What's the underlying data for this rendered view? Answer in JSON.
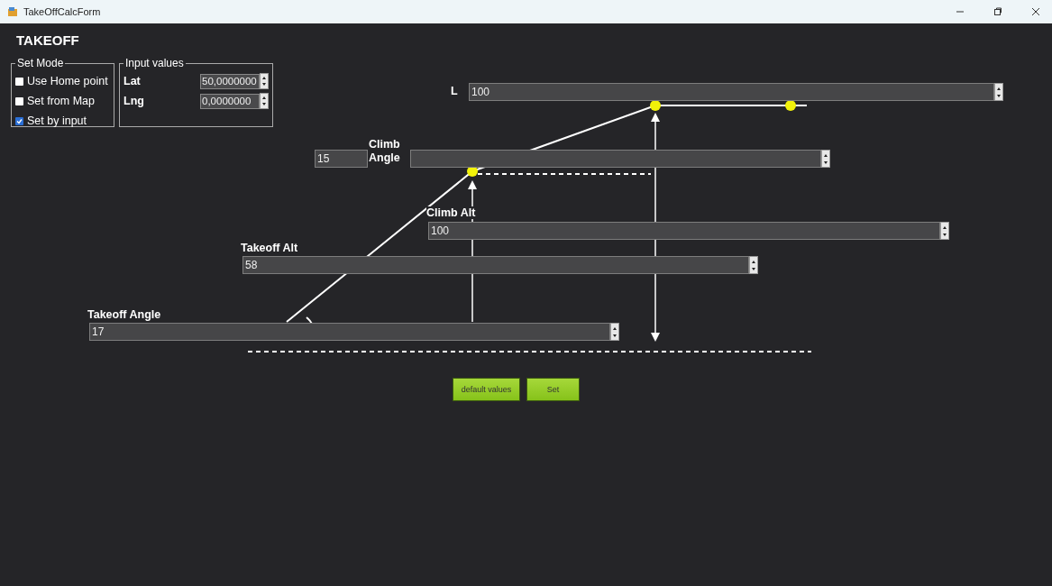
{
  "window": {
    "title": "TakeOffCalcForm"
  },
  "heading": "TAKEOFF",
  "set_mode": {
    "title": "Set Mode",
    "options": [
      {
        "label": "Use Home point",
        "checked": false
      },
      {
        "label": "Set from Map",
        "checked": false
      },
      {
        "label": "Set by input",
        "checked": true
      }
    ]
  },
  "input_values": {
    "title": "Input values",
    "fields": [
      {
        "label": "Lat",
        "value": "50,0000000"
      },
      {
        "label": "Lng",
        "value": "0,0000000"
      }
    ]
  },
  "diagram": {
    "l": {
      "label": "L",
      "value": "100"
    },
    "climb_angle": {
      "label": "Climb Angle",
      "value": "15"
    },
    "climb_alt": {
      "label": "Climb Alt",
      "value": "100"
    },
    "takeoff_alt": {
      "label": "Takeoff Alt",
      "value": "58"
    },
    "takeoff_angle": {
      "label": "Takeoff Angle",
      "value": "17"
    }
  },
  "buttons": [
    "default values",
    "Set"
  ]
}
